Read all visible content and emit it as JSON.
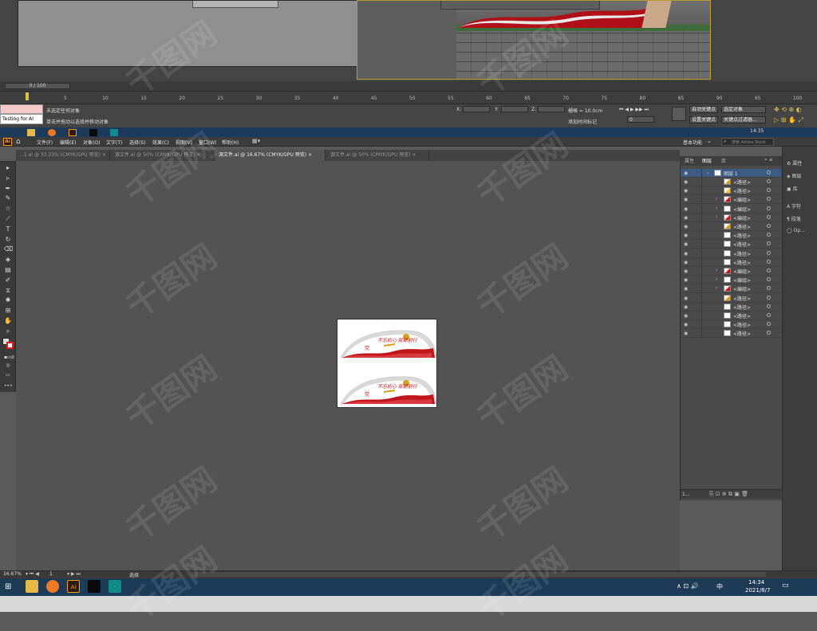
{
  "max": {
    "frame_counter": "0 / 100",
    "ruler_ticks": [
      "5",
      "10",
      "15",
      "20",
      "25",
      "30",
      "35",
      "40",
      "45",
      "50",
      "55",
      "60",
      "65",
      "70",
      "75",
      "80",
      "85",
      "90",
      "95",
      "100"
    ],
    "listener_text": "Testing for AI",
    "status_line1": "未选定任何对象",
    "status_line2": "单击并拖动以选择并移动对象",
    "coord_x_label": "X:",
    "coord_y_label": "Y:",
    "coord_z_label": "Z:",
    "grid_label": "栅格 = 10.0cm",
    "add_time_tag": "添加时间标记",
    "auto_key": "自动关键点",
    "set_key": "设置关键点",
    "selected_object": "选定对象",
    "key_filters": "关键点过滤器...",
    "frame_value": "0",
    "taskbar_time": "14:35"
  },
  "ai": {
    "logo": "Ai",
    "menus": [
      "文件(F)",
      "编辑(E)",
      "对象(O)",
      "文字(T)",
      "选择(S)",
      "效果(C)",
      "视图(V)",
      "窗口(W)",
      "帮助(H)"
    ],
    "workspace": "基本功能",
    "search_placeholder": "搜索 Adobe Stock",
    "tabs": [
      {
        "label": "…1.ai @ 33.33% (CMYK/GPU 预览)",
        "active": false
      },
      {
        "label": "源文件.ai @ 50% (CMYK/GPU 预览)",
        "active": false
      },
      {
        "label": "源文件.ai @ 16.67% (CMYK/GPU 预览)",
        "active": true
      },
      {
        "label": "源文件.ai @ 50% (CMYK/GPU 预览)",
        "active": false
      }
    ],
    "panel_tabs": [
      "属性",
      "图层",
      "库"
    ],
    "layer_top": "图层 1",
    "layers": [
      {
        "name": "<路径>",
        "expand": false
      },
      {
        "name": "<路径>",
        "expand": false
      },
      {
        "name": "<编组>",
        "expand": true
      },
      {
        "name": "<编组>",
        "expand": true
      },
      {
        "name": "<编组>",
        "expand": true
      },
      {
        "name": "<路径>",
        "expand": false
      },
      {
        "name": "<路径>",
        "expand": false
      },
      {
        "name": "<路径>",
        "expand": false
      },
      {
        "name": "<路径>",
        "expand": false
      },
      {
        "name": "<路径>",
        "expand": false
      },
      {
        "name": "<编组>",
        "expand": true
      },
      {
        "name": "<编组>",
        "expand": true
      },
      {
        "name": "<编组>",
        "expand": true
      },
      {
        "name": "<路径>",
        "expand": false
      },
      {
        "name": "<路径>",
        "expand": false
      },
      {
        "name": "<路径>",
        "expand": false
      },
      {
        "name": "<路径>",
        "expand": false
      },
      {
        "name": "<路径>",
        "expand": false
      }
    ],
    "layer_footer": "1...",
    "strip_items": [
      "属性",
      "图层",
      "库",
      "字符",
      "段落",
      "Op..."
    ],
    "zoom": "16.67%",
    "artboard_num": "1",
    "status_tool": "选择",
    "artwork_slogan": "不忘初心 砥砺前行",
    "artwork_seal": "党"
  },
  "taskbar": {
    "time": "14:34",
    "date": "2021/8/7",
    "tray": "中"
  },
  "colors": {
    "accent_red": "#c0161c",
    "accent_gold": "#d4a017",
    "ai_orange": "#ff9a00"
  },
  "watermark": "千图网"
}
